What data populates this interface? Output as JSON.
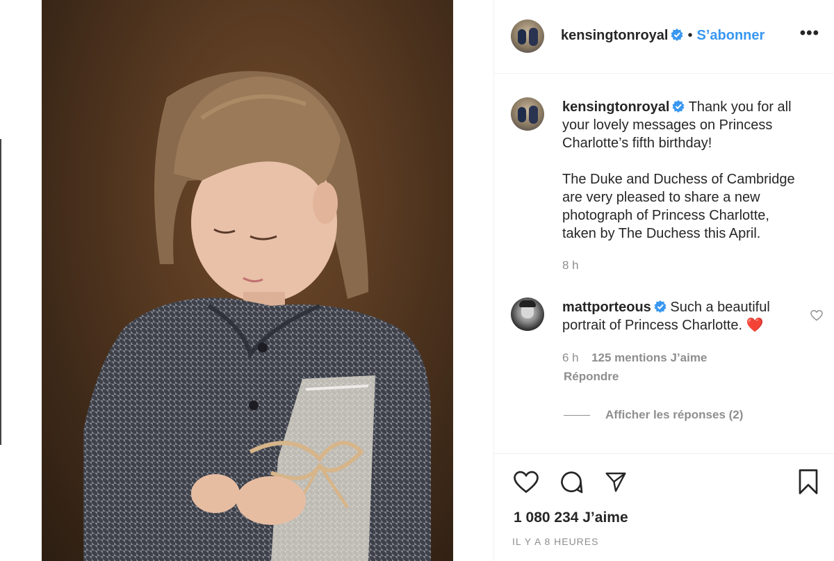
{
  "post": {
    "author": "kensingtonroyal",
    "follow_label": "S’abonner",
    "separator": "•",
    "more_label": "•••"
  },
  "caption": {
    "author": "kensingtonroyal",
    "line1": "Thank you for all",
    "line2": "your lovely messages on Princess",
    "line3": "Charlotte’s fifth birthday!",
    "line4": "The Duke and Duchess of Cambridge",
    "line5": "are very pleased to share a new",
    "line6": "photograph of Princess Charlotte,",
    "line7": "taken by The Duchess this April.",
    "time": "8 h"
  },
  "comment": {
    "author": "mattporteous",
    "line1": "Such a beautiful",
    "line2": "portrait of Princess Charlotte.",
    "emoji": "❤️",
    "time": "6 h",
    "likes": "125 mentions J’aime",
    "reply_label": "Répondre",
    "view_replies": "Afficher les réponses (2)"
  },
  "footer": {
    "likes": "1 080 234 J’aime",
    "ago": "IL Y A 8 HEURES"
  },
  "icons": {
    "verified_color": "#3897f0",
    "like": "heart-icon",
    "comment": "comment-icon",
    "share": "share-icon",
    "save": "bookmark-icon"
  }
}
